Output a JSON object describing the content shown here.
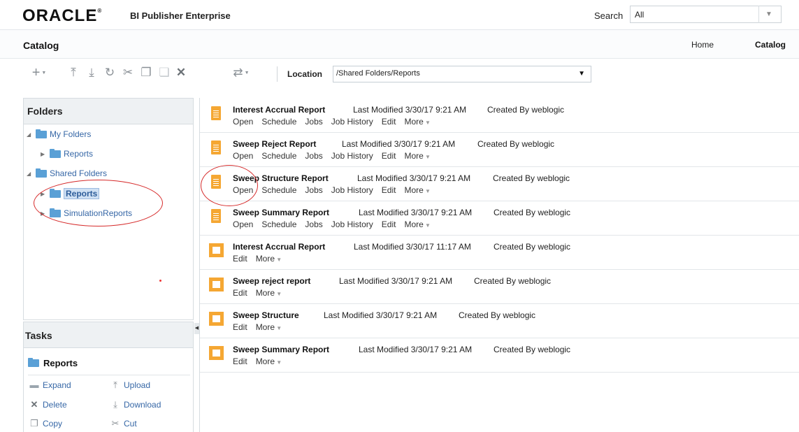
{
  "header": {
    "brand": "ORACLE",
    "trademark": "®",
    "product": "BI Publisher Enterprise",
    "search_label": "Search",
    "search_scope": "All"
  },
  "page": {
    "title": "Catalog",
    "nav": {
      "home": "Home",
      "catalog": "Catalog"
    }
  },
  "toolbar": {
    "location_label": "Location",
    "location_value": "/Shared Folders/Reports"
  },
  "folders": {
    "title": "Folders",
    "tree": [
      {
        "label": "My Folders"
      },
      {
        "label": "Reports"
      },
      {
        "label": "Shared Folders"
      },
      {
        "label": "Reports"
      },
      {
        "label": "SimulationReports"
      }
    ]
  },
  "tasks": {
    "title": "Tasks",
    "folder": "Reports",
    "items": {
      "expand": "Expand",
      "upload": "Upload",
      "delete": "Delete",
      "download": "Download",
      "copy": "Copy",
      "cut": "Cut"
    }
  },
  "items": [
    {
      "name": "Interest Accrual Report",
      "modified": "Last Modified 3/30/17 9:21 AM",
      "created": "Created By weblogic",
      "icon": "report-icon",
      "actions": [
        "Open",
        "Schedule",
        "Jobs",
        "Job History",
        "Edit",
        "More"
      ]
    },
    {
      "name": "Sweep Reject Report",
      "modified": "Last Modified 3/30/17 9:21 AM",
      "created": "Created By weblogic",
      "icon": "report-icon",
      "actions": [
        "Open",
        "Schedule",
        "Jobs",
        "Job History",
        "Edit",
        "More"
      ]
    },
    {
      "name": "Sweep Structure Report",
      "modified": "Last Modified 3/30/17 9:21 AM",
      "created": "Created By weblogic",
      "icon": "report-icon",
      "actions": [
        "Open",
        "Schedule",
        "Jobs",
        "Job History",
        "Edit",
        "More"
      ]
    },
    {
      "name": "Sweep Summary Report",
      "modified": "Last Modified 3/30/17 9:21 AM",
      "created": "Created By weblogic",
      "icon": "report-icon",
      "actions": [
        "Open",
        "Schedule",
        "Jobs",
        "Job History",
        "Edit",
        "More"
      ]
    },
    {
      "name": "Interest Accrual Report",
      "modified": "Last Modified 3/30/17 11:17 AM",
      "created": "Created By weblogic",
      "icon": "data-model-icon",
      "actions": [
        "Edit",
        "More"
      ]
    },
    {
      "name": "Sweep reject report",
      "modified": "Last Modified 3/30/17 9:21 AM",
      "created": "Created By weblogic",
      "icon": "data-model-icon",
      "actions": [
        "Edit",
        "More"
      ]
    },
    {
      "name": "Sweep Structure",
      "modified": "Last Modified 3/30/17 9:21 AM",
      "created": "Created By weblogic",
      "icon": "data-model-icon",
      "actions": [
        "Edit",
        "More"
      ]
    },
    {
      "name": "Sweep Summary Report",
      "modified": "Last Modified 3/30/17 9:21 AM",
      "created": "Created By weblogic",
      "icon": "data-model-icon",
      "actions": [
        "Edit",
        "More"
      ]
    }
  ],
  "colors": {
    "accent": "#f5a733",
    "link": "#3667a6",
    "folder": "#5aa0d6",
    "annotation": "#d62b2b"
  }
}
